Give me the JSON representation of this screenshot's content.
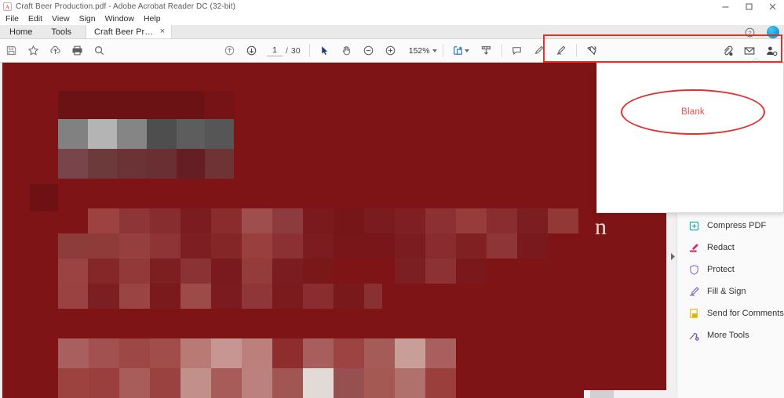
{
  "window": {
    "title": "Craft Beer Production.pdf - Adobe Acrobat Reader DC (32-bit)",
    "minimize_label": "Minimize",
    "maximize_label": "Maximize",
    "close_label": "Close"
  },
  "menu": {
    "items": [
      {
        "label": "File"
      },
      {
        "label": "Edit"
      },
      {
        "label": "View"
      },
      {
        "label": "Sign"
      },
      {
        "label": "Window"
      },
      {
        "label": "Help"
      }
    ]
  },
  "tabs": {
    "home_label": "Home",
    "tools_label": "Tools",
    "document_label": "Craft Beer Producti...",
    "close_glyph": "×",
    "help_icon": "help-circle-icon",
    "avatar_icon": "user-avatar"
  },
  "toolbar": {
    "save_icon": "save-icon",
    "favorite_icon": "star-icon",
    "upload_icon": "cloud-upload-icon",
    "print_icon": "print-icon",
    "find_icon": "search-icon",
    "prev_page_icon": "arrow-up-circle-icon",
    "next_page_icon": "arrow-down-circle-icon",
    "page_current": "1",
    "page_separator": "/",
    "page_total": "30",
    "select_tool_icon": "cursor-arrow-icon",
    "hand_tool_icon": "hand-icon",
    "zoom_out_icon": "minus-circle-icon",
    "zoom_in_icon": "plus-circle-icon",
    "zoom_value": "152%",
    "zoom_dropdown_icon": "chevron-down-icon",
    "fit_page_icon": "fit-page-icon",
    "fit_dropdown_icon": "chevron-down-icon",
    "read_mode_icon": "read-mode-icon",
    "comment_icon": "comment-icon",
    "highlight_icon": "highlight-pen-icon",
    "draw_icon": "draw-pen-icon",
    "stamp_icon": "stamp-icon",
    "attach_icon": "attach-cloud-icon",
    "email_icon": "envelope-icon",
    "share_user_icon": "share-user-icon",
    "highlight_color": "#ee2b2b"
  },
  "popup": {
    "annotation_text": "Blank",
    "annotation_color": "#e25252",
    "ellipse_color": "#e03030"
  },
  "document": {
    "stray_glyph": "n",
    "background_color": "#7e1416"
  },
  "tools_panel": {
    "items": [
      {
        "label": "Compress PDF",
        "icon": "compress-pdf-icon",
        "color": "#17a2a2"
      },
      {
        "label": "Redact",
        "icon": "redact-icon",
        "color": "#d6246e"
      },
      {
        "label": "Protect",
        "icon": "shield-icon",
        "color": "#8b6fd4"
      },
      {
        "label": "Fill & Sign",
        "icon": "fill-sign-icon",
        "color": "#7a5fd3"
      },
      {
        "label": "Send for Comments",
        "icon": "send-comments-icon",
        "color": "#e0b400"
      },
      {
        "label": "More Tools",
        "icon": "more-tools-icon",
        "color": "#6b4fb8"
      }
    ],
    "collapse_icon": "chevron-right-icon"
  }
}
